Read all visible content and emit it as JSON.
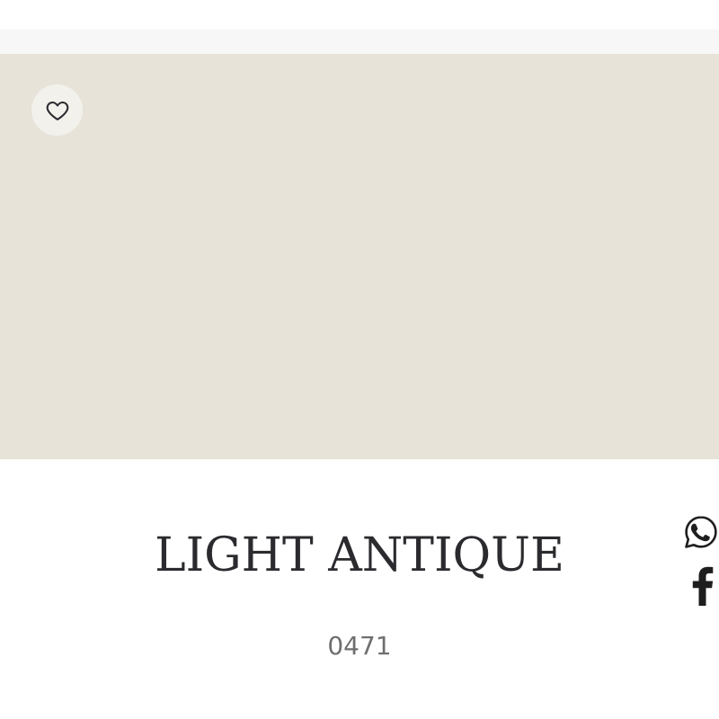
{
  "product": {
    "name": "LIGHT ANTIQUE",
    "code": "0471",
    "swatch_color": "#e7e3d9"
  },
  "favorite": {
    "icon": "heart-outline-icon",
    "selected": false
  },
  "share": {
    "whatsapp_icon": "whatsapp-icon",
    "facebook_icon": "facebook-icon"
  },
  "colors": {
    "top_bar": "#f7f7f7",
    "text_dark": "#2b2b2f",
    "text_muted": "#6f6f6f",
    "fav_bg": "#f3f1ec"
  }
}
